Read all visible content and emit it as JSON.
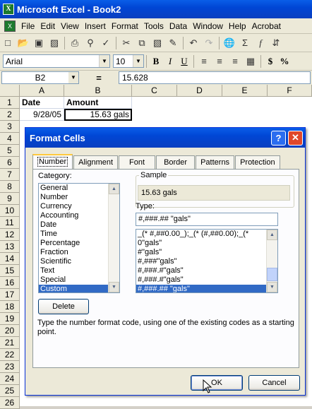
{
  "window": {
    "title": "Microsoft Excel - Book2",
    "app_icon": "excel-icon"
  },
  "menu": [
    "File",
    "Edit",
    "View",
    "Insert",
    "Format",
    "Tools",
    "Data",
    "Window",
    "Help",
    "Acrobat"
  ],
  "toolbar": {
    "font_name": "Arial",
    "font_size": "10",
    "bold": "B",
    "italic": "I",
    "underline": "U",
    "currency": "$",
    "percent": "%"
  },
  "formula_bar": {
    "name_box": "B2",
    "equals": "=",
    "value": "15.628"
  },
  "columns": [
    "A",
    "B",
    "C",
    "D",
    "E",
    "F"
  ],
  "rows": [
    "1",
    "2",
    "3",
    "4",
    "5",
    "6",
    "7",
    "8",
    "9",
    "10",
    "11",
    "12",
    "13",
    "14",
    "15",
    "16",
    "17",
    "18",
    "19",
    "20",
    "21",
    "22",
    "23",
    "24",
    "25",
    "26"
  ],
  "cells": {
    "A1": "Date",
    "B1": "Amount",
    "A2": "9/28/05",
    "B2": "15.63 gals"
  },
  "dialog": {
    "title": "Format Cells",
    "tabs": [
      "Number",
      "Alignment",
      "Font",
      "Border",
      "Patterns",
      "Protection"
    ],
    "active_tab": "Number",
    "category_label": "Category:",
    "categories": [
      "General",
      "Number",
      "Currency",
      "Accounting",
      "Date",
      "Time",
      "Percentage",
      "Fraction",
      "Scientific",
      "Text",
      "Special",
      "Custom"
    ],
    "selected_category": "Custom",
    "sample_label": "Sample",
    "sample_value": "15.63 gals",
    "type_label": "Type:",
    "type_value": "#,###.## \"gals\"",
    "type_list": [
      "_(* #,##0.00_);_(* (#,##0.00);_(* ",
      "0\"gals\"",
      "#\"gals\"",
      "#,###\"gals\"",
      "#,###.#\"gals\"",
      "#,###.#\"gals\"",
      "#,###.## \"gals\""
    ],
    "delete_button": "Delete",
    "description": "Type the number format code, using one of the existing codes as a starting point.",
    "ok_button": "OK",
    "cancel_button": "Cancel"
  }
}
